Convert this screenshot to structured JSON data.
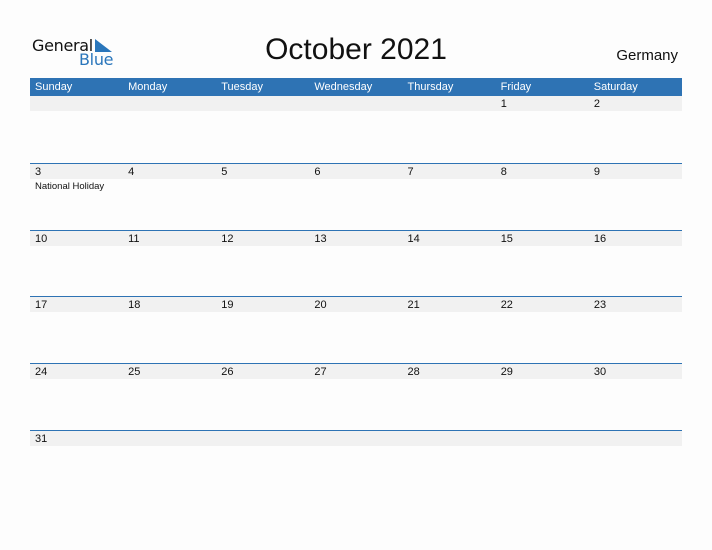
{
  "logo": {
    "general": "General",
    "blue": "Blue",
    "icon": "triangle-flag-icon"
  },
  "title": "October 2021",
  "country": "Germany",
  "weekdays": [
    "Sunday",
    "Monday",
    "Tuesday",
    "Wednesday",
    "Thursday",
    "Friday",
    "Saturday"
  ],
  "colors": {
    "accent": "#2e73b4",
    "strip": "#f1f1f1"
  },
  "weeks": [
    [
      {
        "day": ""
      },
      {
        "day": ""
      },
      {
        "day": ""
      },
      {
        "day": ""
      },
      {
        "day": ""
      },
      {
        "day": "1"
      },
      {
        "day": "2"
      }
    ],
    [
      {
        "day": "3",
        "event": "National Holiday"
      },
      {
        "day": "4"
      },
      {
        "day": "5"
      },
      {
        "day": "6"
      },
      {
        "day": "7"
      },
      {
        "day": "8"
      },
      {
        "day": "9"
      }
    ],
    [
      {
        "day": "10"
      },
      {
        "day": "11"
      },
      {
        "day": "12"
      },
      {
        "day": "13"
      },
      {
        "day": "14"
      },
      {
        "day": "15"
      },
      {
        "day": "16"
      }
    ],
    [
      {
        "day": "17"
      },
      {
        "day": "18"
      },
      {
        "day": "19"
      },
      {
        "day": "20"
      },
      {
        "day": "21"
      },
      {
        "day": "22"
      },
      {
        "day": "23"
      }
    ],
    [
      {
        "day": "24"
      },
      {
        "day": "25"
      },
      {
        "day": "26"
      },
      {
        "day": "27"
      },
      {
        "day": "28"
      },
      {
        "day": "29"
      },
      {
        "day": "30"
      }
    ],
    [
      {
        "day": "31"
      },
      {
        "day": ""
      },
      {
        "day": ""
      },
      {
        "day": ""
      },
      {
        "day": ""
      },
      {
        "day": ""
      },
      {
        "day": ""
      }
    ]
  ]
}
